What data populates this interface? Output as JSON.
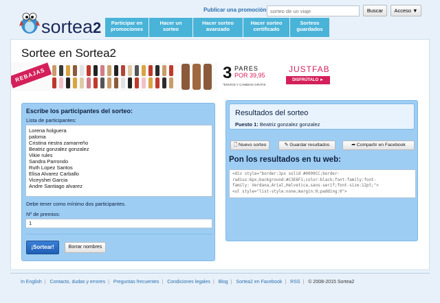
{
  "header": {
    "brand": "sortea",
    "brand_suffix": "2",
    "publicar_label": "Publicar una promoción",
    "search_placeholder": "sorteo de un viaje",
    "search_button": "Buscar",
    "acceso_button": "Acceso ▼",
    "nav": [
      {
        "line1": "Participar en",
        "line2": "promociones"
      },
      {
        "line1": "Hacer un",
        "line2": "sorteo"
      },
      {
        "line1": "Hacer sorteo",
        "line2": "avanzado"
      },
      {
        "line1": "Hacer sorteo",
        "line2": "certificado"
      },
      {
        "line1": "Sorteos",
        "line2": "guardados"
      }
    ]
  },
  "main": {
    "title": "Sortee en Sortea2"
  },
  "banner": {
    "rebajas": "REBAJAS",
    "number": "3",
    "pares": "PARES",
    "por": "POR 39,95",
    "envios": "*ENVÍOS Y CAMBIOS GRATIS",
    "brand": "JUSTFAB",
    "cta": "DISFRÚTALO ►"
  },
  "left_panel": {
    "title": "Escribe los participantes del sorteo:",
    "list_label": "Lista de participantes:",
    "participants": [
      "Lorena holguera",
      "paloma",
      "Cristina riestra zamarreño",
      "Beatriz gonzalez gonzalez",
      "Vikie rules",
      "Sandra Parrondo",
      "Ruth Lopez Santos",
      "Elisa Alvarez Carballo",
      "Viceyshei Garcia",
      "Andre Santiago alvarez"
    ],
    "min_note": "Debe tener como mínimo dos participantes.",
    "premios_label": "Nº de premios:",
    "premios_value": "1",
    "sortear_button": "¡Sortear!",
    "borrar_button": "Borrar nombres"
  },
  "right_panel": {
    "results_title": "Resultados del sorteo",
    "puesto_label": "Puesto 1:",
    "puesto_value": "Beatriz gonzalez gonzalez",
    "btn_nuevo": "Nuevo sorteo",
    "btn_guardar": "Guardar resultados",
    "btn_compartir": "Compartir en Facebook",
    "web_title": "Pon los resultados en tu web:",
    "code_lines": [
      "<div style=\"border:1px solid #0099CC;border-",
      "radius:6px;background:#C3E6F1;color:black;font-family:font-",
      "family: Verdana,Arial,Helvetica,sans-serif;font-size:12pt;\">",
      "<ul style=\"list-style:none;margin:0;padding:0\">"
    ]
  },
  "footer": {
    "links": [
      "In English",
      "Contacto, dudas y errores",
      "Preguntas frecuentes",
      "Condiciones legales",
      "Blog",
      "Sortea2 en Facebook",
      "RSS"
    ],
    "copyright": "© 2008-2015 Sortea2"
  },
  "colors": {
    "nav_bg": "#4ab3d8",
    "panel_bg": "#9ecdf3",
    "link": "#2a6fb0",
    "accent_pink": "#d4205a"
  }
}
